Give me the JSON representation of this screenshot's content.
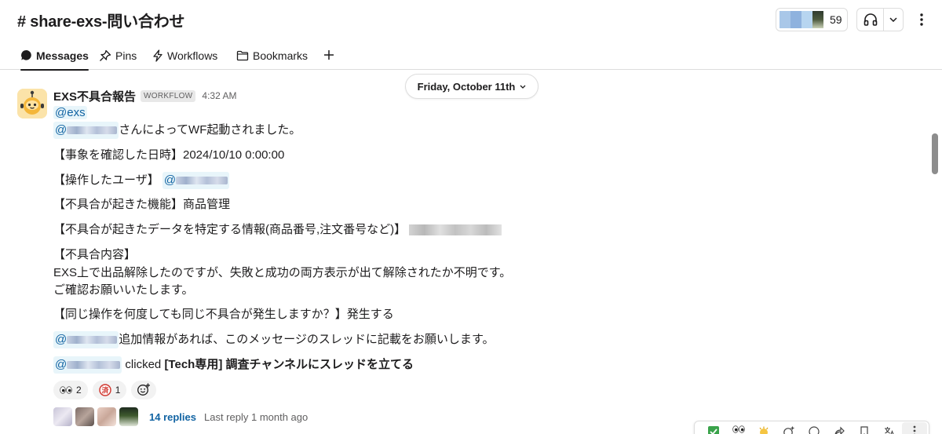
{
  "header": {
    "channel_name": "# share-exs-問い合わせ",
    "member_count": "59",
    "icons": {
      "huddle": "headphones-icon",
      "dropdown": "chevron-down-icon",
      "more": "vertical-ellipsis-icon"
    }
  },
  "tabs": [
    {
      "label": "Messages",
      "icon": "message-bubble-icon",
      "active": true
    },
    {
      "label": "Pins",
      "icon": "pin-icon",
      "active": false
    },
    {
      "label": "Workflows",
      "icon": "lightning-icon",
      "active": false
    },
    {
      "label": "Bookmarks",
      "icon": "folder-icon",
      "active": false
    }
  ],
  "date_divider": "Friday, October 11th",
  "message": {
    "sender": "EXS不具合報告",
    "badge": "WORKFLOW",
    "time": "4:32 AM",
    "mention_group": "@exs",
    "wf_line": {
      "prefix": "@",
      "text": "さんによってWF起動されました。"
    },
    "datetime_line": "【事象を確認した日時】2024/10/10 0:00:00",
    "operator_line": {
      "label": "【操作したユーザ】",
      "prefix": "@"
    },
    "feature_line": "【不具合が起きた機能】商品管理",
    "identify_line": "【不具合が起きたデータを特定する情報(商品番号,注文番号など)】",
    "content_label": "【不具合内容】",
    "content_body": "EXS上で出品解除したのですが、失敗と成功の両方表示が出て解除されたか不明です。",
    "content_body2": "ご確認お願いいたします。",
    "repeat_line": "【同じ操作を何度しても同じ不具合が発生しますか？】発生する",
    "additional_line": {
      "prefix": "@",
      "text": "追加情報があれば、このメッセージのスレッドに記載をお願いします。"
    },
    "clicked_line": {
      "prefix": "@",
      "action": "clicked",
      "button_text": "[Tech専用] 調査チャンネルにスレッドを立てる"
    }
  },
  "reactions": [
    {
      "emoji": "eyes-icon",
      "count": "2"
    },
    {
      "emoji": "settled-stamp-icon",
      "stamp_text": "済",
      "count": "1"
    }
  ],
  "thread": {
    "replies": "14 replies",
    "last_reply": "Last reply 1 month ago"
  },
  "colors": {
    "link": "#1264a3",
    "mention_bg": "#e8f5fa",
    "muted": "#616061",
    "border": "#dddddd"
  }
}
